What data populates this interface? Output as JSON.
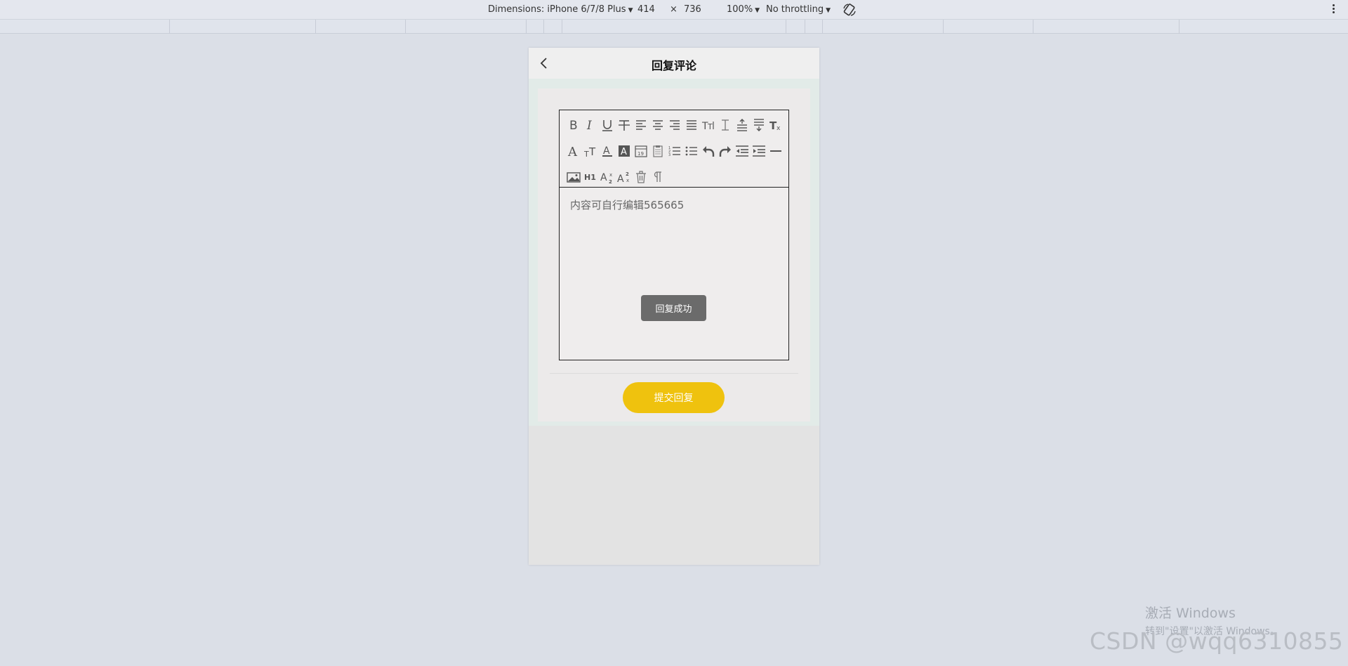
{
  "devtools": {
    "dimensions_label": "Dimensions: iPhone 6/7/8 Plus",
    "width": "414",
    "times": "×",
    "height": "736",
    "zoom": "100%",
    "throttling": "No throttling"
  },
  "page": {
    "title": "回复评论",
    "editor_content": "内容可自行编辑565665",
    "toast": "回复成功",
    "submit_label": "提交回复"
  },
  "toolbar": {
    "icons_row1": [
      "bold-icon",
      "italic-icon",
      "underline-icon",
      "strikethrough-icon",
      "align-left-icon",
      "align-center-icon",
      "align-right-icon",
      "align-justify-icon",
      "font-size-icon",
      "line-height-icon",
      "paragraph-spacing-before-icon",
      "paragraph-spacing-after-icon",
      "clear-format-icon"
    ],
    "icons_row2": [
      "font-family-icon",
      "font-case-icon",
      "font-color-icon",
      "background-color-icon",
      "date-icon",
      "paste-icon",
      "ordered-list-icon",
      "unordered-list-icon",
      "undo-icon",
      "redo-icon",
      "outdent-icon",
      "indent-icon",
      "horizontal-rule-icon"
    ],
    "icons_row3": [
      "image-icon",
      "heading-icon",
      "subscript-icon",
      "superscript-icon",
      "delete-icon",
      "paragraph-icon"
    ],
    "h1_label": "H1"
  },
  "overlay": {
    "activate_title": "激活 Windows",
    "activate_sub": "转到\"设置\"以激活 Windows。",
    "csdn": "CSDN @wqq6310855"
  },
  "colors": {
    "accent_button": "#efc20e",
    "toast_bg": "#6b6b6b",
    "page_bg": "#dbdfe7"
  }
}
